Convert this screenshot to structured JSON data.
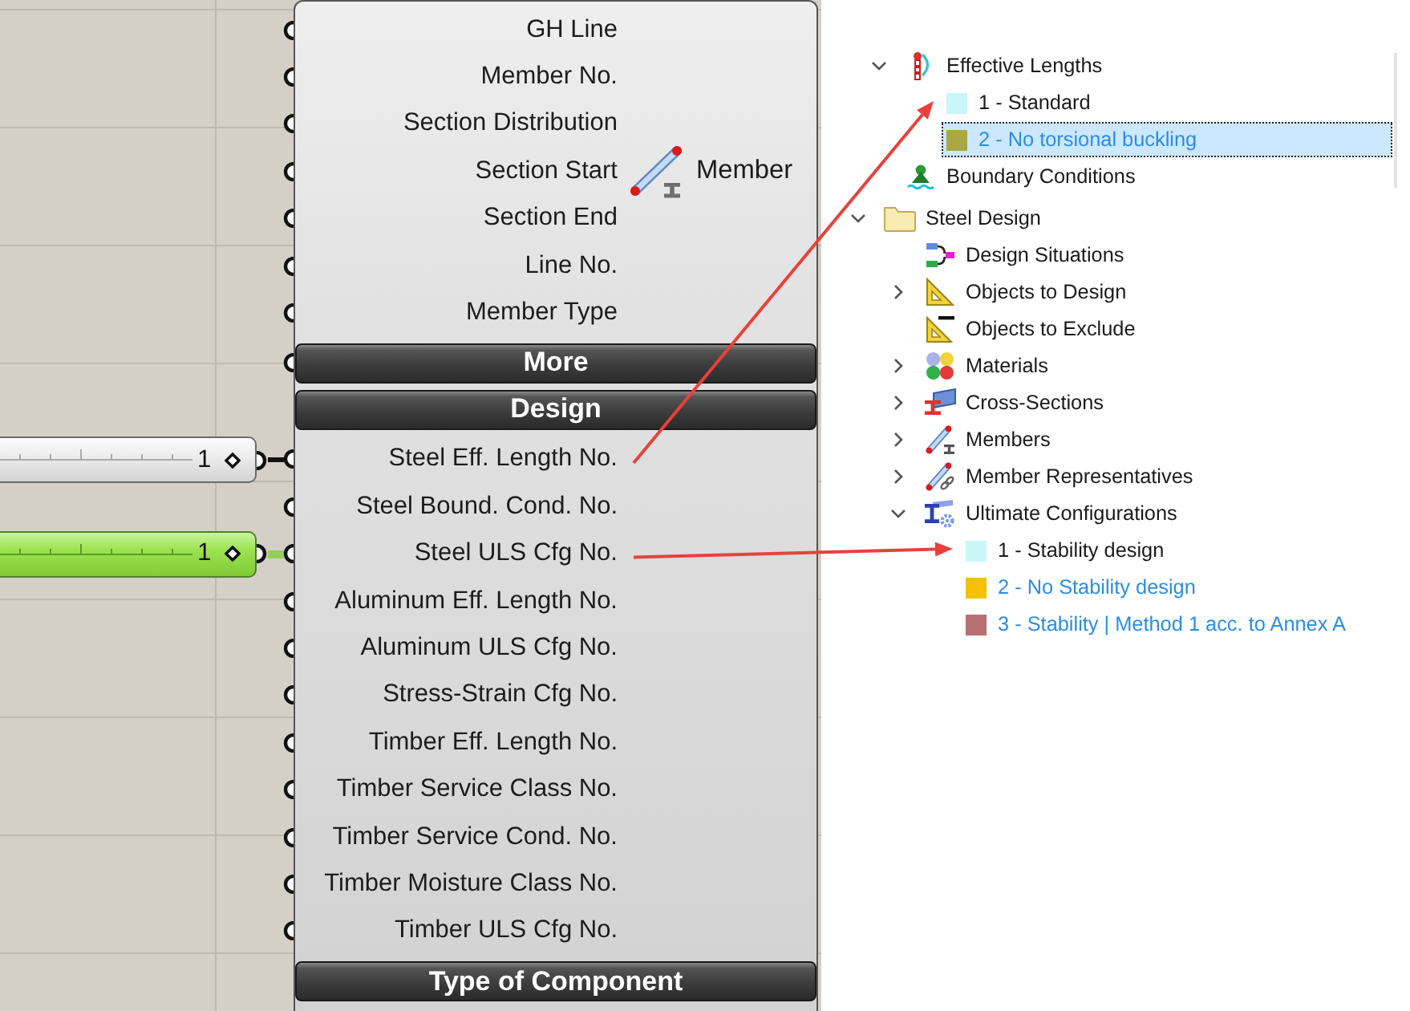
{
  "canvas": {
    "component": {
      "title": "Member",
      "rows": [
        {
          "kind": "input",
          "label": "GH Line"
        },
        {
          "kind": "input",
          "label": "Member No."
        },
        {
          "kind": "input",
          "label": "Section Distribution"
        },
        {
          "kind": "input",
          "label": "Section Start"
        },
        {
          "kind": "input",
          "label": "Section End"
        },
        {
          "kind": "input",
          "label": "Line No."
        },
        {
          "kind": "input",
          "label": "Member Type"
        },
        {
          "kind": "bar",
          "label": "More",
          "port": true
        },
        {
          "kind": "bar",
          "label": "Design",
          "port": false
        },
        {
          "kind": "input",
          "label": "Steel Eff. Length No.",
          "source": {
            "value": "1",
            "selected": false
          },
          "arrow": true
        },
        {
          "kind": "input",
          "label": "Steel Bound. Cond. No."
        },
        {
          "kind": "input",
          "label": "Steel ULS Cfg No.",
          "source": {
            "value": "1",
            "selected": true
          },
          "arrow": true
        },
        {
          "kind": "input",
          "label": "Aluminum Eff. Length No."
        },
        {
          "kind": "input",
          "label": "Aluminum ULS Cfg No."
        },
        {
          "kind": "input",
          "label": "Stress-Strain Cfg No."
        },
        {
          "kind": "input",
          "label": "Timber Eff. Length No."
        },
        {
          "kind": "input",
          "label": "Timber Service Class No."
        },
        {
          "kind": "input",
          "label": "Timber Service Cond. No."
        },
        {
          "kind": "input",
          "label": "Timber Moisture Class No."
        },
        {
          "kind": "input",
          "label": "Timber ULS Cfg No."
        },
        {
          "kind": "bar",
          "label": "Type of Component",
          "port": false
        }
      ]
    }
  },
  "upper_tree": {
    "items": [
      {
        "kind": "lengths",
        "label": "Effective Lengths",
        "expanded": true,
        "selected": false,
        "children": [
          {
            "kind": "swatch",
            "label": "1 - Standard",
            "color": "#c9f7f9",
            "selected": false,
            "accented": false,
            "arrow_target": true
          },
          {
            "kind": "swatch",
            "label": "2 - No torsional buckling",
            "color": "#aaa844",
            "selected": true,
            "accented": true
          }
        ]
      },
      {
        "kind": "support",
        "label": "Boundary Conditions",
        "selected": false
      }
    ]
  },
  "lower_tree": {
    "items": [
      {
        "kind": "folder",
        "label": "Steel Design",
        "expanded": true,
        "selected": false,
        "children": [
          {
            "kind": "situations",
            "label": "Design Situations",
            "selected": false
          },
          {
            "kind": "setsquare",
            "label": "Objects to Design",
            "expanded": false,
            "selected": false
          },
          {
            "kind": "exclusion",
            "label": "Objects to Exclude",
            "selected": false
          },
          {
            "kind": "materials",
            "label": "Materials",
            "expanded": false,
            "selected": false
          },
          {
            "kind": "section",
            "label": "Cross-Sections",
            "expanded": false,
            "selected": false
          },
          {
            "kind": "member",
            "label": "Members",
            "expanded": false,
            "selected": false
          },
          {
            "kind": "representative",
            "label": "Member Representatives",
            "expanded": false,
            "selected": false
          },
          {
            "kind": "configuration",
            "label": "Ultimate Configurations",
            "expanded": true,
            "selected": false,
            "children": [
              {
                "kind": "swatch",
                "label": "1 - Stability design",
                "color": "#c9f7f9",
                "selected": false,
                "accented": false,
                "arrow_target": true
              },
              {
                "kind": "swatch",
                "label": "2 - No Stability design",
                "color": "#f2c200",
                "selected": false,
                "accented": true
              },
              {
                "kind": "swatch",
                "label": "3 - Stability | Method 1 acc. to Annex A",
                "color": "#b87070",
                "selected": false,
                "accented": true
              }
            ]
          }
        ]
      }
    ]
  }
}
